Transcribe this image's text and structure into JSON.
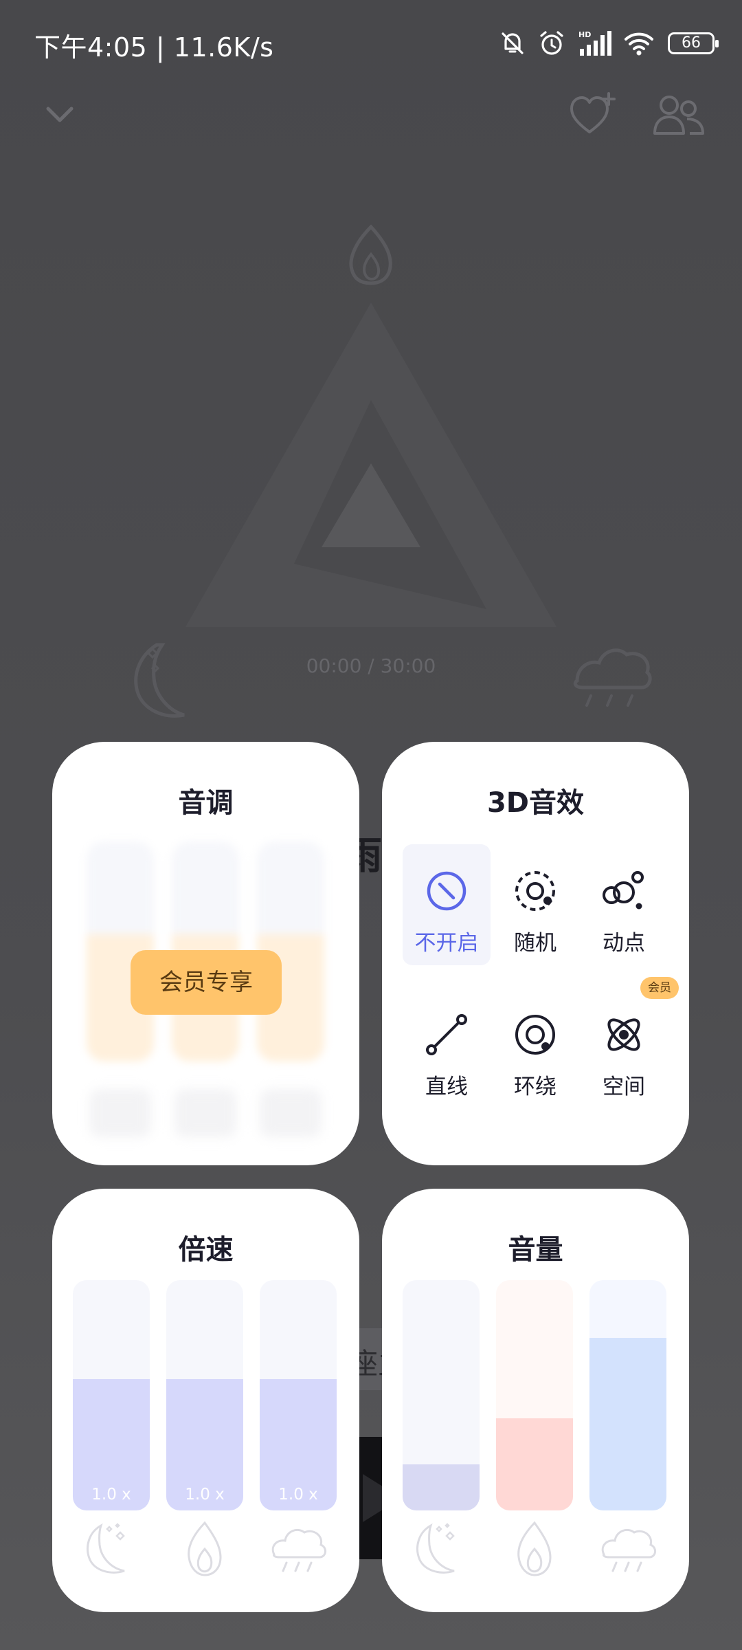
{
  "status_bar": {
    "time_speed": "下午4:05 | 11.6K/s",
    "battery": "66"
  },
  "player": {
    "timer": "00:00 / 30:00",
    "title_fragment": "雨亻",
    "pill_fragment": "座主"
  },
  "panels": {
    "pitch": {
      "title": "音调",
      "locked_button": "会员专享"
    },
    "effects3d": {
      "title": "3D音效",
      "items": [
        {
          "label": "不开启",
          "icon": "disabled-icon",
          "selected": true
        },
        {
          "label": "随机",
          "icon": "random-orbit-icon",
          "selected": false
        },
        {
          "label": "动点",
          "icon": "moving-points-icon",
          "selected": false
        },
        {
          "label": "直线",
          "icon": "line-icon",
          "selected": false
        },
        {
          "label": "环绕",
          "icon": "surround-icon",
          "selected": false
        },
        {
          "label": "空间",
          "icon": "atom-space-icon",
          "selected": false,
          "badge": "会员"
        }
      ]
    },
    "speed": {
      "title": "倍速",
      "sliders": [
        {
          "sound": "night-moon-icon",
          "value_label": "1.0 x",
          "level": 0.57
        },
        {
          "sound": "fire-icon",
          "value_label": "1.0 x",
          "level": 0.57
        },
        {
          "sound": "rain-cloud-icon",
          "value_label": "1.0 x",
          "level": 0.57
        }
      ]
    },
    "volume": {
      "title": "音量",
      "sliders": [
        {
          "sound": "night-moon-icon",
          "level": 0.2
        },
        {
          "sound": "fire-icon",
          "level": 0.4
        },
        {
          "sound": "rain-cloud-icon",
          "level": 0.75
        }
      ]
    }
  },
  "colors": {
    "accent": "#5b67e8",
    "vip": "#ffc46b",
    "speed_fill": "#d6d8fb",
    "speed_track": "#f6f7fc",
    "volume_fill": [
      "#d8d9f3",
      "#ffd8d5",
      "#d3e2fd"
    ],
    "volume_track": [
      "#f6f7fc",
      "#fff8f6",
      "#f4f7ff"
    ]
  }
}
